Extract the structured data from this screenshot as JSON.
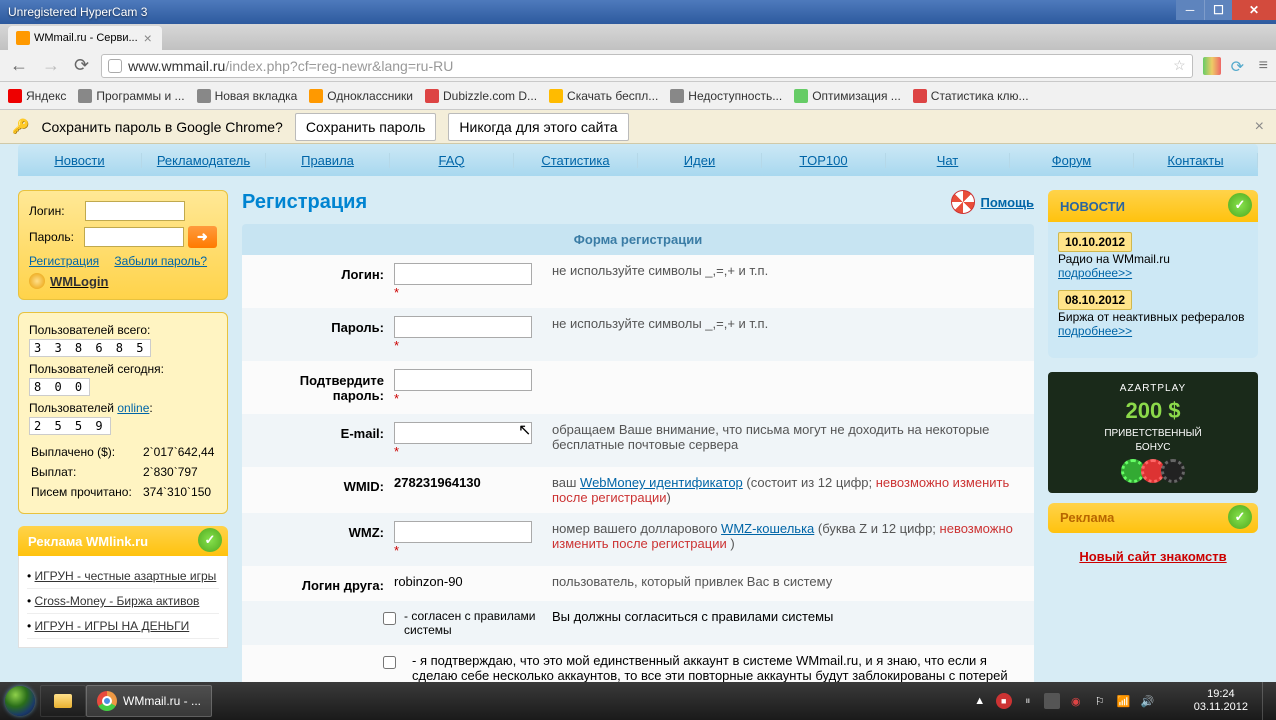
{
  "window": {
    "title": "Unregistered HyperCam 3"
  },
  "tab": {
    "title": "WMmail.ru - Серви..."
  },
  "addressbar": {
    "host": "www.wmmail.ru",
    "path": "/index.php?cf=reg-newr&lang=ru-RU"
  },
  "bookmarks": [
    {
      "icon": "#e00",
      "label": "Яндекс"
    },
    {
      "icon": "#888",
      "label": "Программы и ..."
    },
    {
      "icon": "#888",
      "label": "Новая вкладка"
    },
    {
      "icon": "#f90",
      "label": "Одноклассники"
    },
    {
      "icon": "#d44",
      "label": "Dubizzle.com D..."
    },
    {
      "icon": "#fb0",
      "label": "Скачать беспл..."
    },
    {
      "icon": "#888",
      "label": "Недоступность..."
    },
    {
      "icon": "#6c6",
      "label": "Оптимизация ..."
    },
    {
      "icon": "#d44",
      "label": "Статистика клю..."
    }
  ],
  "infobar": {
    "text": "Сохранить пароль в Google Chrome?",
    "save": "Сохранить пароль",
    "never": "Никогда для этого сайта"
  },
  "nav": [
    "Новости",
    "Рекламодатель",
    "Правила",
    "FAQ",
    "Статистика",
    "Идеи",
    "TOP100",
    "Чат",
    "Форум",
    "Контакты"
  ],
  "login": {
    "login_label": "Логин:",
    "pass_label": "Пароль:",
    "reg": "Регистрация",
    "forgot": "Забыли пароль?",
    "wmlogin": "WMLogin"
  },
  "stats": {
    "total_label": "Пользователей всего:",
    "total": "3 3 8 6 8 5",
    "today_label": "Пользователей сегодня:",
    "today": "      8 0 0",
    "online_label_a": "Пользователей ",
    "online_label_b": "online",
    "online_label_c": ":",
    "online": "    2 5 5 9",
    "paid_label": "Выплачено ($):",
    "paid": "2`017`642,44",
    "payments_label": "Выплат:",
    "payments": "2`830`797",
    "read_label": "Писем прочитано:",
    "read": "374`310`150"
  },
  "wmlink": {
    "header": "Реклама WMlink.ru",
    "links": [
      "ИГРУН - честные азартные игры",
      "Cross-Money - Биржа активов",
      "ИГРУН - ИГРЫ НА ДЕНЬГИ"
    ]
  },
  "page": {
    "title": "Регистрация",
    "help": "Помощь",
    "form_title": "Форма регистрации"
  },
  "form": {
    "login": {
      "label": "Логин:",
      "hint": "не используйте символы _,=,+ и т.п."
    },
    "password": {
      "label": "Пароль:",
      "hint": "не используйте символы _,=,+ и т.п."
    },
    "confirm": {
      "label": "Подтвердите пароль:"
    },
    "email": {
      "label": "E-mail:",
      "hint": "обращаем Ваше внимание, что письма могут не доходить на некоторые бесплатные почтовые сервера"
    },
    "wmid": {
      "label": "WMID:",
      "value": "278231964130",
      "hint_a": "ваш ",
      "hint_link": "WebMoney идентификатор",
      "hint_b": " (состоит из 12 цифр; ",
      "hint_warn": "невозможно изменить после регистрации",
      "hint_c": ")"
    },
    "wmz": {
      "label": "WMZ:",
      "hint_a": "номер вашего долларового ",
      "hint_link": "WMZ-кошелька",
      "hint_b": " (буква Z и 12 цифр; ",
      "hint_warn": "невозможно изменить после регистрации",
      "hint_c": " )"
    },
    "ref": {
      "label": "Логин друга:",
      "value": "robinzon-90",
      "hint": "пользователь, который привлек Вас в систему"
    },
    "agree": {
      "text_a": "- согласен с ",
      "text_link": "правилами",
      "text_b": " системы",
      "hint": "Вы должны согласиться с правилами системы"
    },
    "single": {
      "text": "- я подтверждаю, что это мой единственный аккаунт в системе WMmail.ru, и я знаю, что если я сделаю себе несколько аккаунтов, то все эти повторные аккаунты будут заблокированы с потерей всех рефералов и средств на балансе"
    }
  },
  "news": {
    "header": "НОВОСТИ",
    "items": [
      {
        "date": "10.10.2012",
        "text": "Радио на WMmail.ru",
        "more": "подробнее>>"
      },
      {
        "date": "08.10.2012",
        "text": "Биржа от неактивных рефералов",
        "more": "подробнее>>"
      }
    ]
  },
  "banner": {
    "brand": "AZARTPLAY",
    "amount": "200 $",
    "sub": "ПРИВЕТСТВЕННЫЙ\nБОНУС"
  },
  "ad2": {
    "header": "Реклама",
    "link": "Новый сайт знакомств"
  },
  "taskbar": {
    "item": "WMmail.ru - ...",
    "time": "19:24",
    "date": "03.11.2012"
  }
}
